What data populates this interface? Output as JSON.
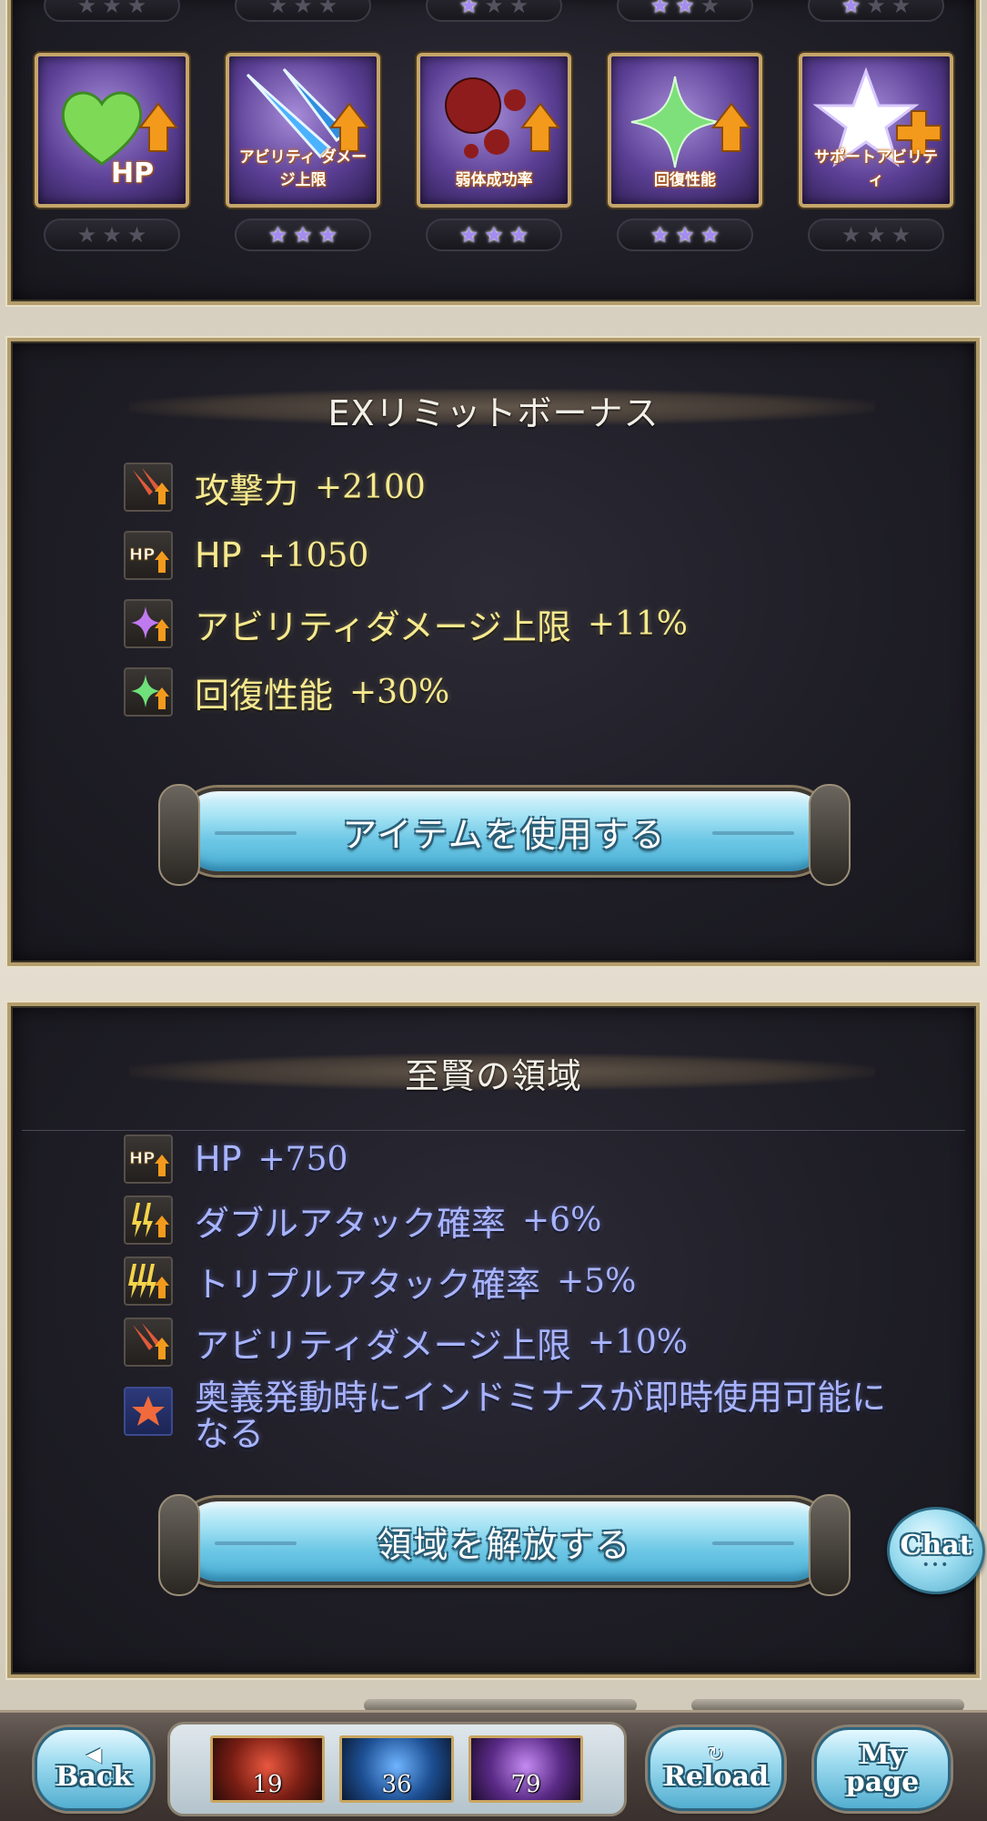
{
  "top_grid": {
    "top_row_stars": [
      {
        "on": 0,
        "total": 3
      },
      {
        "on": 0,
        "total": 3
      },
      {
        "on": 1,
        "total": 3
      },
      {
        "on": 2,
        "total": 3
      },
      {
        "on": 1,
        "total": 3
      }
    ],
    "tiles": [
      {
        "name": "hp",
        "caption": "HP",
        "stars_on": 0,
        "stars_total": 3
      },
      {
        "name": "ability-damage-cap",
        "caption": "アビリティ ダメージ上限",
        "stars_on": 3,
        "stars_total": 3
      },
      {
        "name": "debuff-success",
        "caption": "弱体成功率",
        "stars_on": 3,
        "stars_total": 3
      },
      {
        "name": "healing",
        "caption": "回復性能",
        "stars_on": 3,
        "stars_total": 3
      },
      {
        "name": "support-ability",
        "caption": "サポートアビリティ",
        "stars_on": 0,
        "stars_total": 3
      }
    ]
  },
  "ex_limit": {
    "title": "EXリミットボーナス",
    "rows": [
      {
        "icon": "attack-up-icon",
        "label": "攻撃力",
        "value": "+2100"
      },
      {
        "icon": "hp-up-icon",
        "label": "HP",
        "value": "+1050"
      },
      {
        "icon": "ability-cap-up-icon",
        "label": "アビリティダメージ上限",
        "value": "+11%"
      },
      {
        "icon": "heal-up-icon",
        "label": "回復性能",
        "value": "+30%"
      }
    ],
    "button_label": "アイテムを使用する"
  },
  "domain": {
    "title": "至賢の領域",
    "rows": [
      {
        "icon": "hp-up-icon",
        "label": "HP",
        "value": "+750"
      },
      {
        "icon": "double-attack-icon",
        "label": "ダブルアタック確率",
        "value": "+6%"
      },
      {
        "icon": "triple-attack-icon",
        "label": "トリプルアタック確率",
        "value": "+5%"
      },
      {
        "icon": "ability-damage-cap-icon",
        "label": "アビリティダメージ上限",
        "value": "+10%"
      }
    ],
    "special_line1": "奥義発動時にインドミナスが即時使用可能に",
    "special_line2": "なる",
    "button_label": "領域を解放する"
  },
  "chat": {
    "label": "Chat",
    "dots": "•••"
  },
  "bottom_bar": {
    "back": {
      "glyph": "◀",
      "label": "Back"
    },
    "reload": {
      "glyph": "↻",
      "label": "Reload"
    },
    "mypage": {
      "line1": "My",
      "line2": "page"
    },
    "quick_slots": [
      {
        "count": "19",
        "color": "#c0392b"
      },
      {
        "count": "36",
        "color": "#2f6fbf"
      },
      {
        "count": "79",
        "color": "#8e44ad"
      }
    ]
  }
}
